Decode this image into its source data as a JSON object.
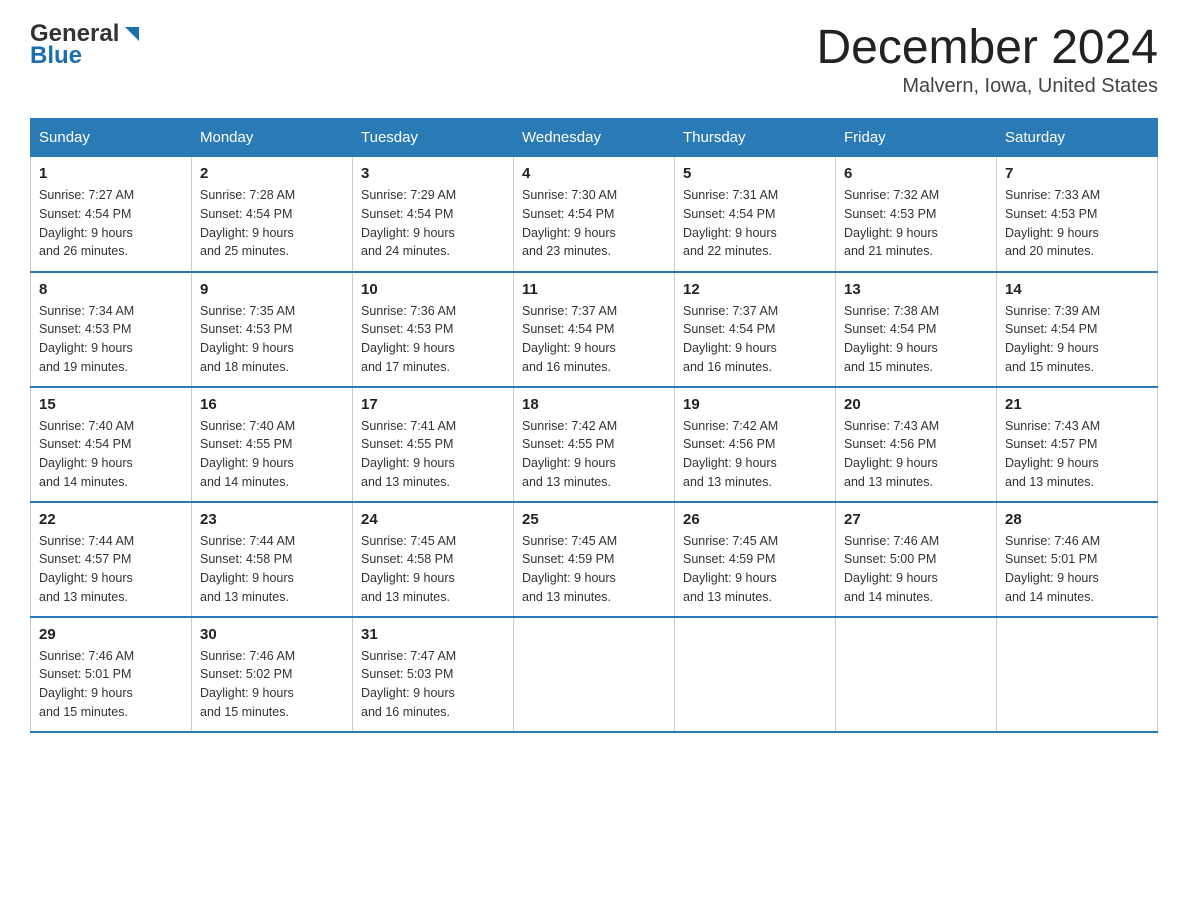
{
  "logo": {
    "general": "General",
    "blue": "Blue",
    "arrow_color": "#1a6faf"
  },
  "title": "December 2024",
  "subtitle": "Malvern, Iowa, United States",
  "days_of_week": [
    "Sunday",
    "Monday",
    "Tuesday",
    "Wednesday",
    "Thursday",
    "Friday",
    "Saturday"
  ],
  "weeks": [
    [
      {
        "num": "1",
        "sunrise": "7:27 AM",
        "sunset": "4:54 PM",
        "daylight": "9 hours and 26 minutes."
      },
      {
        "num": "2",
        "sunrise": "7:28 AM",
        "sunset": "4:54 PM",
        "daylight": "9 hours and 25 minutes."
      },
      {
        "num": "3",
        "sunrise": "7:29 AM",
        "sunset": "4:54 PM",
        "daylight": "9 hours and 24 minutes."
      },
      {
        "num": "4",
        "sunrise": "7:30 AM",
        "sunset": "4:54 PM",
        "daylight": "9 hours and 23 minutes."
      },
      {
        "num": "5",
        "sunrise": "7:31 AM",
        "sunset": "4:54 PM",
        "daylight": "9 hours and 22 minutes."
      },
      {
        "num": "6",
        "sunrise": "7:32 AM",
        "sunset": "4:53 PM",
        "daylight": "9 hours and 21 minutes."
      },
      {
        "num": "7",
        "sunrise": "7:33 AM",
        "sunset": "4:53 PM",
        "daylight": "9 hours and 20 minutes."
      }
    ],
    [
      {
        "num": "8",
        "sunrise": "7:34 AM",
        "sunset": "4:53 PM",
        "daylight": "9 hours and 19 minutes."
      },
      {
        "num": "9",
        "sunrise": "7:35 AM",
        "sunset": "4:53 PM",
        "daylight": "9 hours and 18 minutes."
      },
      {
        "num": "10",
        "sunrise": "7:36 AM",
        "sunset": "4:53 PM",
        "daylight": "9 hours and 17 minutes."
      },
      {
        "num": "11",
        "sunrise": "7:37 AM",
        "sunset": "4:54 PM",
        "daylight": "9 hours and 16 minutes."
      },
      {
        "num": "12",
        "sunrise": "7:37 AM",
        "sunset": "4:54 PM",
        "daylight": "9 hours and 16 minutes."
      },
      {
        "num": "13",
        "sunrise": "7:38 AM",
        "sunset": "4:54 PM",
        "daylight": "9 hours and 15 minutes."
      },
      {
        "num": "14",
        "sunrise": "7:39 AM",
        "sunset": "4:54 PM",
        "daylight": "9 hours and 15 minutes."
      }
    ],
    [
      {
        "num": "15",
        "sunrise": "7:40 AM",
        "sunset": "4:54 PM",
        "daylight": "9 hours and 14 minutes."
      },
      {
        "num": "16",
        "sunrise": "7:40 AM",
        "sunset": "4:55 PM",
        "daylight": "9 hours and 14 minutes."
      },
      {
        "num": "17",
        "sunrise": "7:41 AM",
        "sunset": "4:55 PM",
        "daylight": "9 hours and 13 minutes."
      },
      {
        "num": "18",
        "sunrise": "7:42 AM",
        "sunset": "4:55 PM",
        "daylight": "9 hours and 13 minutes."
      },
      {
        "num": "19",
        "sunrise": "7:42 AM",
        "sunset": "4:56 PM",
        "daylight": "9 hours and 13 minutes."
      },
      {
        "num": "20",
        "sunrise": "7:43 AM",
        "sunset": "4:56 PM",
        "daylight": "9 hours and 13 minutes."
      },
      {
        "num": "21",
        "sunrise": "7:43 AM",
        "sunset": "4:57 PM",
        "daylight": "9 hours and 13 minutes."
      }
    ],
    [
      {
        "num": "22",
        "sunrise": "7:44 AM",
        "sunset": "4:57 PM",
        "daylight": "9 hours and 13 minutes."
      },
      {
        "num": "23",
        "sunrise": "7:44 AM",
        "sunset": "4:58 PM",
        "daylight": "9 hours and 13 minutes."
      },
      {
        "num": "24",
        "sunrise": "7:45 AM",
        "sunset": "4:58 PM",
        "daylight": "9 hours and 13 minutes."
      },
      {
        "num": "25",
        "sunrise": "7:45 AM",
        "sunset": "4:59 PM",
        "daylight": "9 hours and 13 minutes."
      },
      {
        "num": "26",
        "sunrise": "7:45 AM",
        "sunset": "4:59 PM",
        "daylight": "9 hours and 13 minutes."
      },
      {
        "num": "27",
        "sunrise": "7:46 AM",
        "sunset": "5:00 PM",
        "daylight": "9 hours and 14 minutes."
      },
      {
        "num": "28",
        "sunrise": "7:46 AM",
        "sunset": "5:01 PM",
        "daylight": "9 hours and 14 minutes."
      }
    ],
    [
      {
        "num": "29",
        "sunrise": "7:46 AM",
        "sunset": "5:01 PM",
        "daylight": "9 hours and 15 minutes."
      },
      {
        "num": "30",
        "sunrise": "7:46 AM",
        "sunset": "5:02 PM",
        "daylight": "9 hours and 15 minutes."
      },
      {
        "num": "31",
        "sunrise": "7:47 AM",
        "sunset": "5:03 PM",
        "daylight": "9 hours and 16 minutes."
      },
      null,
      null,
      null,
      null
    ]
  ],
  "labels": {
    "sunrise": "Sunrise:",
    "sunset": "Sunset:",
    "daylight": "Daylight:"
  }
}
